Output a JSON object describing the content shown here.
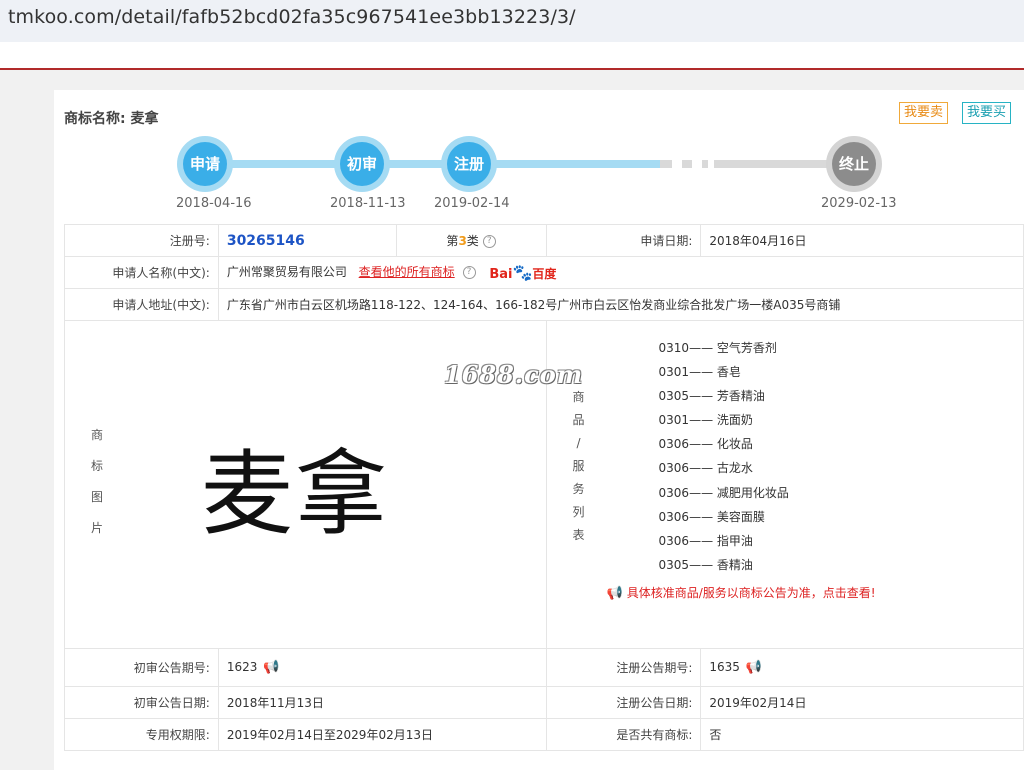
{
  "browser": {
    "url": "tmkoo.com/detail/fafb52bcd02fa35c967541ee3bb13223/3/"
  },
  "header": {
    "title_label": "商标名称:",
    "title_value": "麦拿",
    "sell_button": "我要卖",
    "buy_button": "我要买"
  },
  "timeline": [
    {
      "label": "申请",
      "date": "2018-04-16",
      "status": "done"
    },
    {
      "label": "初审",
      "date": "2018-11-13",
      "status": "done"
    },
    {
      "label": "注册",
      "date": "2019-02-14",
      "status": "done"
    },
    {
      "label": "终止",
      "date": "2029-02-13",
      "status": "pending"
    }
  ],
  "details": {
    "reg_no_label": "注册号:",
    "reg_no": "30265146",
    "class_prefix": "第",
    "class_num": "3",
    "class_suffix": "类",
    "apply_date_label": "申请日期:",
    "apply_date": "2018年04月16日",
    "applicant_label": "申请人名称(中文):",
    "applicant": "广州常聚贸易有限公司",
    "applicant_link": "查看他的所有商标",
    "baidu_bai": "Bai",
    "baidu_paw": "🐾",
    "baidu_du": "百度",
    "address_label": "申请人地址(中文):",
    "address": "广东省广州市白云区机场路118-122、124-164、166-182号广州市白云区怡发商业综合批发广场一楼A035号商铺",
    "image_label_chars": [
      "商",
      "标",
      "图",
      "片"
    ],
    "trademark_text": "麦拿",
    "goods_label_chars": [
      "商",
      "品",
      "/",
      "服",
      "务",
      "列",
      "表"
    ],
    "goods": [
      "0310—— 空气芳香剂",
      "0301—— 香皂",
      "0305—— 芳香精油",
      "0301—— 洗面奶",
      "0306—— 化妆品",
      "0306—— 古龙水",
      "0306—— 减肥用化妆品",
      "0306—— 美容面膜",
      "0306—— 指甲油",
      "0305—— 香精油"
    ],
    "goods_notice": "具体核准商品/服务以商标公告为准，点击查看!",
    "prelim_no_label": "初审公告期号:",
    "prelim_no": "1623",
    "reg_pub_no_label": "注册公告期号:",
    "reg_pub_no": "1635",
    "prelim_date_label": "初审公告日期:",
    "prelim_date": "2018年11月13日",
    "reg_pub_date_label": "注册公告日期:",
    "reg_pub_date": "2019年02月14日",
    "exclusive_label": "专用权期限:",
    "exclusive": "2019年02月14日至2029年02月13日",
    "shared_label": "是否共有商标:",
    "shared": "否"
  },
  "watermark": "1688.com",
  "colors": {
    "accent_blue": "#3aaee8",
    "timeline_light": "#a5dbf3",
    "link_red": "#d22222",
    "divider_red": "#b12a2a"
  }
}
